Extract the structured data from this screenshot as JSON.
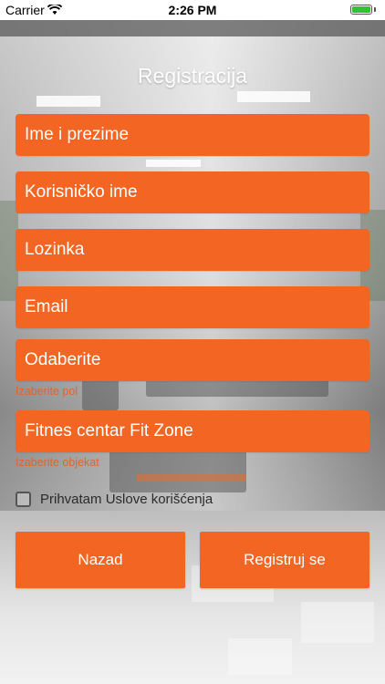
{
  "status_bar": {
    "carrier": "Carrier",
    "time": "2:26 PM",
    "battery_percent": 100
  },
  "title": "Registracija",
  "fields": {
    "full_name": "Ime i prezime",
    "username": "Korisničko ime",
    "password": "Lozinka",
    "email": "Email",
    "gender_select": "Odaberite",
    "gender_hint": "Izaberite pol",
    "facility_select": "Fitnes centar Fit Zone",
    "facility_hint": "Izaberite objekat"
  },
  "terms": {
    "label": "Prihvatam Uslove korišćenja",
    "checked": false
  },
  "buttons": {
    "back": "Nazad",
    "register": "Registruj se"
  },
  "colors": {
    "accent": "#f26522",
    "hint": "#e0652a"
  }
}
